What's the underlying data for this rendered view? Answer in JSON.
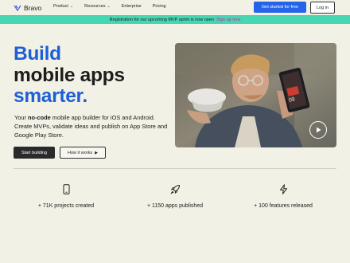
{
  "nav": {
    "logo_text": "Bravo",
    "links": [
      "Product",
      "Resources",
      "Enterprise",
      "Pricing"
    ],
    "cta_label": "Get started for free",
    "login_label": "Log in"
  },
  "banner": {
    "text": "Registration for our upcoming MVP sprint is now open",
    "link_label": "Sign up now"
  },
  "hero": {
    "title_line1": "Build",
    "title_line2": "mobile apps",
    "title_line3": "smarter.",
    "body_prefix": "Your ",
    "body_bold": "no-code",
    "body_rest": " mobile app builder for iOS and Android. Create MVPs, validate ideas and publish on App Store and Google Play Store.",
    "primary_button": "Start building",
    "secondary_button": "How it works"
  },
  "video": {
    "phone_text": "09"
  },
  "features": [
    {
      "icon": "phone-icon",
      "label": "+ 71K projects created"
    },
    {
      "icon": "rocket-icon",
      "label": "+ 1150 apps published"
    },
    {
      "icon": "lightning-icon",
      "label": "+ 100 features released"
    }
  ],
  "colors": {
    "background": "#f1f1e6",
    "accent": "#2563eb",
    "headline_blue": "#1f5fd6",
    "banner": "#46d6b1",
    "banner_link": "#d61fa2"
  }
}
